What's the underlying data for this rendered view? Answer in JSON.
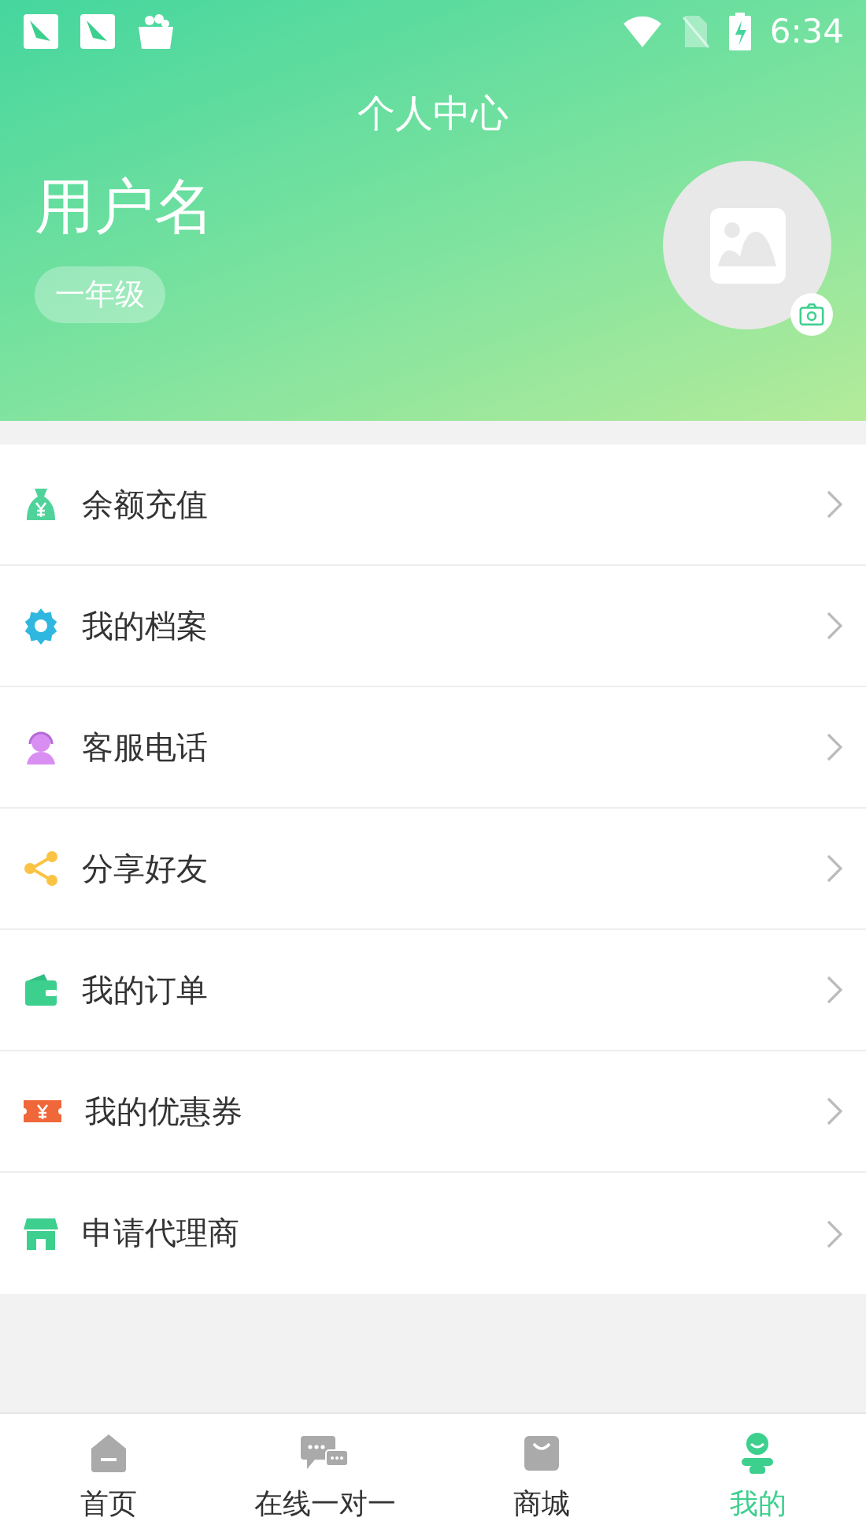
{
  "status_bar": {
    "time": "6:34"
  },
  "header": {
    "title": "个人中心",
    "username": "用户名",
    "grade": "一年级"
  },
  "menu": [
    {
      "kind": "money",
      "label": "余额充值"
    },
    {
      "kind": "gear",
      "label": "我的档案"
    },
    {
      "kind": "agent",
      "label": "客服电话"
    },
    {
      "kind": "share",
      "label": "分享好友"
    },
    {
      "kind": "wallet",
      "label": "我的订单"
    },
    {
      "kind": "ticket",
      "label": "我的优惠券"
    },
    {
      "kind": "store",
      "label": "申请代理商"
    }
  ],
  "tabs": [
    {
      "kind": "home",
      "label": "首页",
      "selected": false
    },
    {
      "kind": "chat",
      "label": "在线一对一",
      "selected": false
    },
    {
      "kind": "bag",
      "label": "商城",
      "selected": false
    },
    {
      "kind": "person",
      "label": "我的",
      "selected": true
    }
  ]
}
